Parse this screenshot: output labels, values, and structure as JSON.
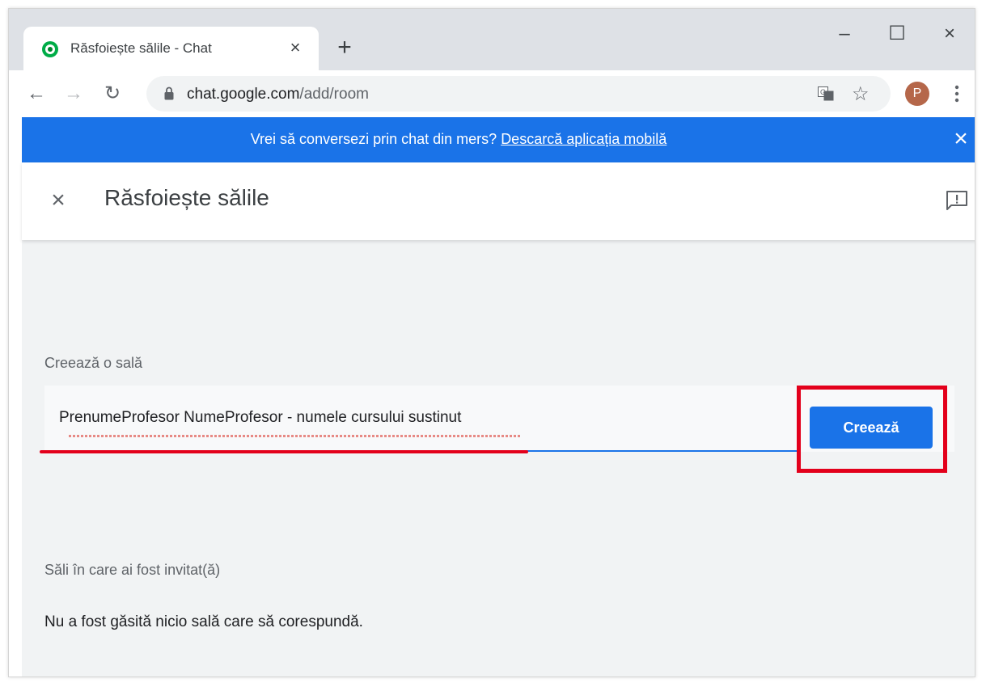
{
  "browser": {
    "tab_title": "Răsfoiește sălile - Chat",
    "tab_close": "×",
    "new_tab": "+",
    "window_controls": {
      "minimize": "–",
      "maximize": "☐",
      "close": "×"
    },
    "url_host": "chat.google.com",
    "url_path": "/add/room",
    "profile_initial": "P",
    "icons": {
      "favicon": "google-chat-icon",
      "lock": "lock-icon",
      "translate": "translate-icon",
      "star": "star-icon",
      "menu": "more-vert-icon"
    }
  },
  "banner": {
    "text": "Vrei să conversezi prin chat din mers?",
    "link": "Descarcă aplicația mobilă",
    "close": "×",
    "color": "#1a73e8"
  },
  "header": {
    "close": "×",
    "title": "Răsfoiește sălile",
    "feedback_icon": "feedback-icon"
  },
  "create": {
    "label": "Creează o sală",
    "input_value": "PrenumeProfesor NumeProfesor - numele cursului sustinut",
    "button": "Creează",
    "accent_color": "#1a73e8",
    "annotation_color": "#e3001b"
  },
  "invited": {
    "label": "Săli în care ai fost invitat(ă)",
    "empty_message": "Nu a fost găsită nicio sală care să corespundă."
  }
}
